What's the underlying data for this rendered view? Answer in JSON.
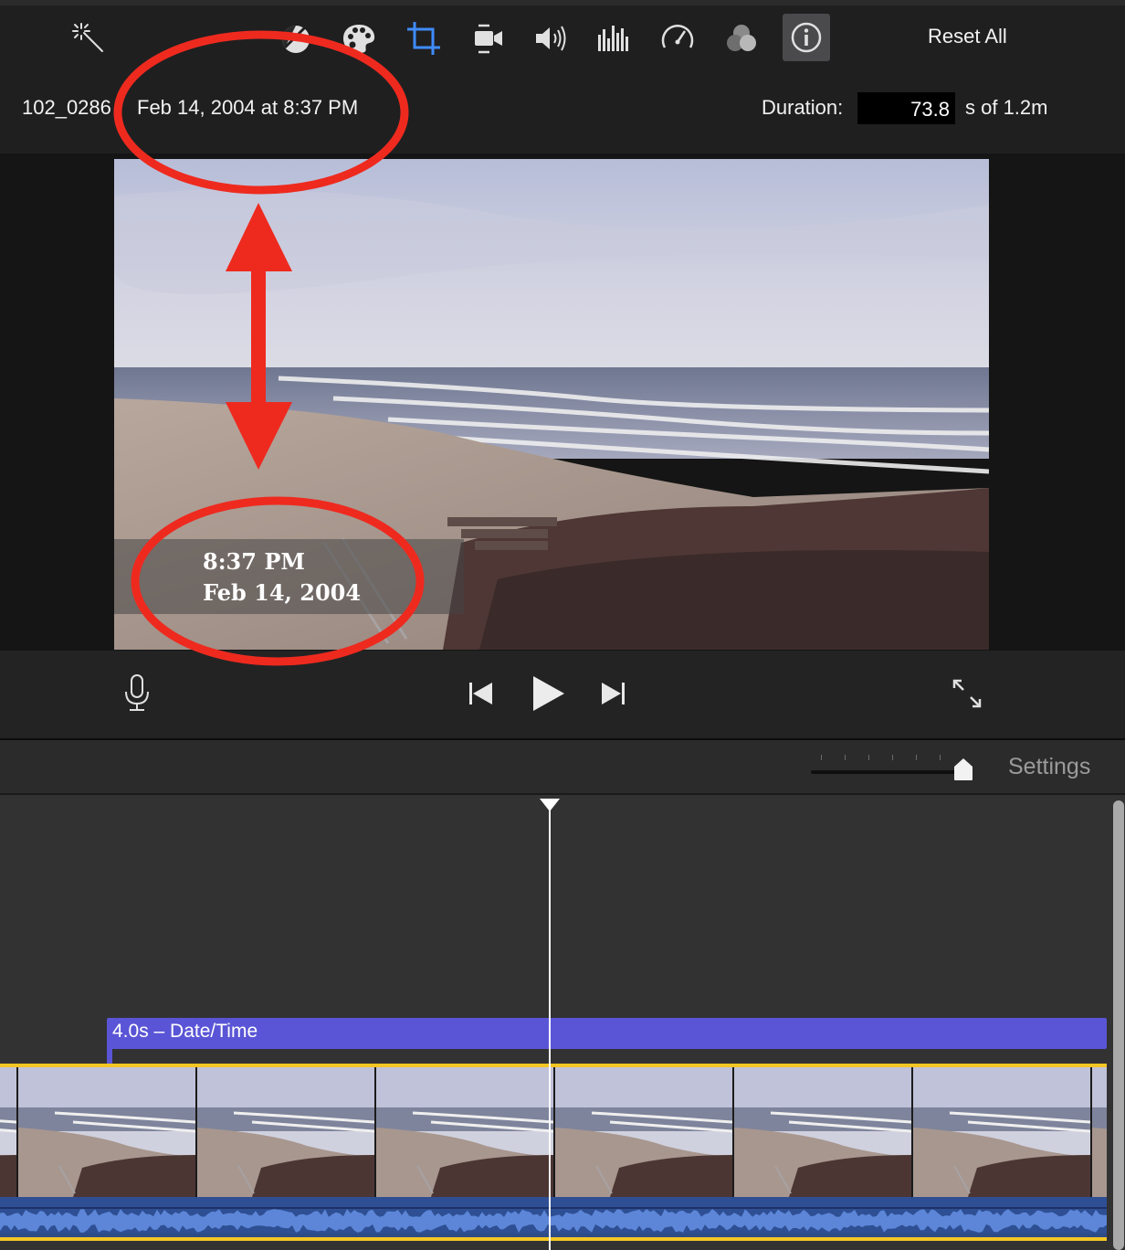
{
  "toolbar": {
    "icons": [
      "magic-wand-icon",
      "color-balance-icon",
      "color-palette-icon",
      "crop-icon",
      "stabilization-camera-icon",
      "volume-icon",
      "equalizer-icon",
      "speed-icon",
      "clip-filter-icon",
      "info-icon"
    ],
    "active_icon": "crop-icon",
    "reset_label": "Reset All",
    "accent_color": "#3f8cff"
  },
  "clip_info": {
    "name": "102_0286",
    "date": "Feb 14, 2004 at 8:37 PM",
    "duration_label": "Duration:",
    "duration_value": "73.8",
    "duration_suffix": "s of 1.2m"
  },
  "viewer": {
    "overlay_time": "8:37 PM",
    "overlay_date": "Feb 14, 2004"
  },
  "transport": {
    "icons": [
      "microphone-icon",
      "skip-back-icon",
      "play-icon",
      "skip-forward-icon",
      "fullscreen-icon"
    ]
  },
  "timeline": {
    "settings_label": "Settings",
    "title_clip_label": "4.0s – Date/Time",
    "title_color": "#5a55d6",
    "clip_border_color": "#f3c623"
  },
  "annotation": {
    "color": "#ee2a1f"
  }
}
